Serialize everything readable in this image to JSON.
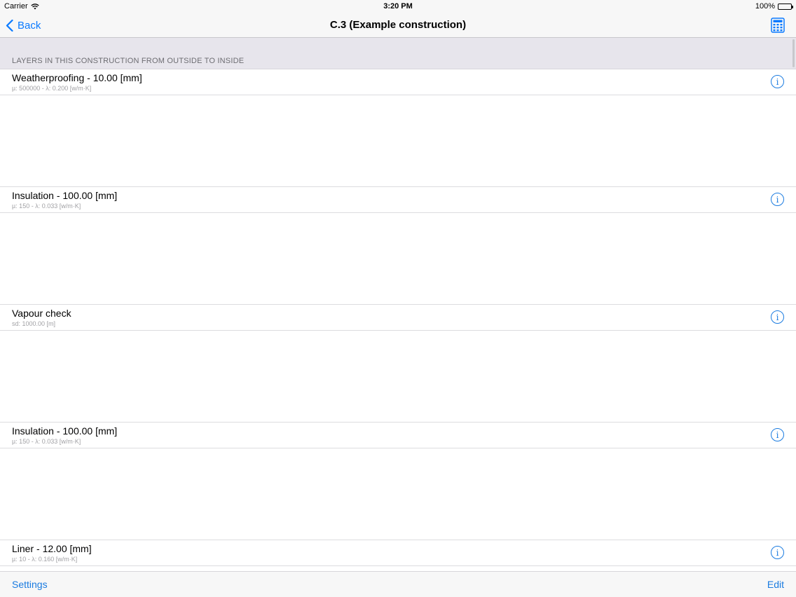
{
  "status_bar": {
    "carrier": "Carrier",
    "time": "3:20 PM",
    "battery": "100%"
  },
  "nav": {
    "back_label": "Back",
    "title": "C.3 (Example construction)",
    "calculator_icon": "calculator-icon"
  },
  "section": {
    "header": "LAYERS IN THIS CONSTRUCTION FROM OUTSIDE TO INSIDE"
  },
  "layers": [
    {
      "title": "Weatherproofing - 10.00 [mm]",
      "subtitle": "µ: 500000 - λ: 0.200 [w/m·K]"
    },
    {
      "title": "Insulation - 100.00 [mm]",
      "subtitle": "µ: 150 - λ: 0.033 [w/m·K]"
    },
    {
      "title": "Vapour check",
      "subtitle": "sd: 1000.00 [m]"
    },
    {
      "title": "Insulation - 100.00 [mm]",
      "subtitle": "µ: 150 - λ: 0.033 [w/m·K]"
    },
    {
      "title": "Liner - 12.00 [mm]",
      "subtitle": "µ: 10 - λ: 0.160 [w/m·K]"
    }
  ],
  "toolbar": {
    "settings_label": "Settings",
    "edit_label": "Edit"
  },
  "colors": {
    "accent": "#0a7aff",
    "section_bg": "#e7e5ec"
  }
}
